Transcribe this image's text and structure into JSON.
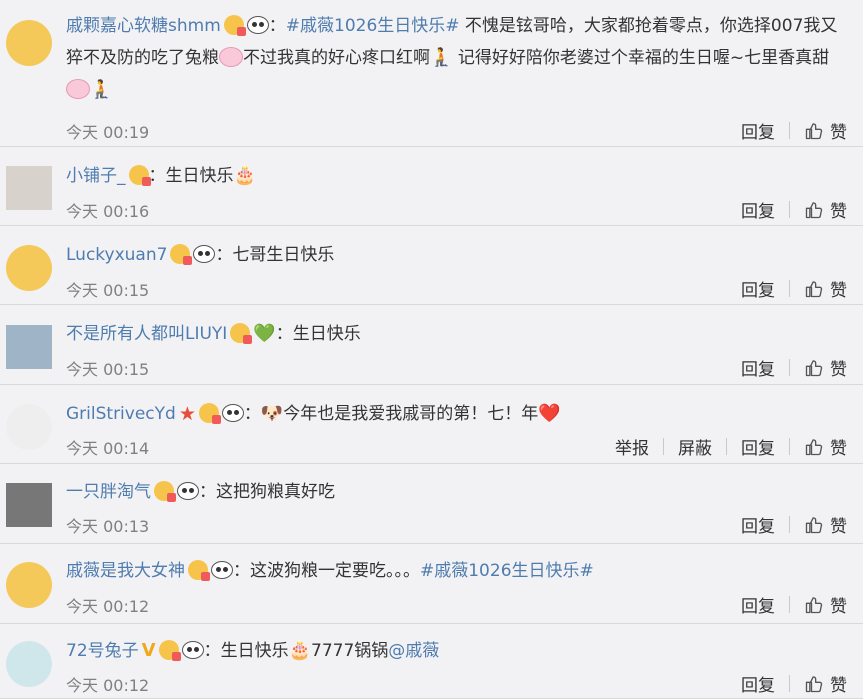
{
  "comments": [
    {
      "user": "戚颗嘉心软糖shmm",
      "badges": [
        "crown",
        "panda"
      ],
      "parts": [
        {
          "t": "：",
          "k": "text"
        },
        {
          "t": "#戚薇1026生日快乐#",
          "k": "link"
        },
        {
          "t": " 不愧是铉哥哈，大家都抢着零点，你选择007我又猝不及防的吃了兔粮",
          "k": "text"
        },
        {
          "t": "",
          "k": "pinkface"
        },
        {
          "t": "不过我真的好心疼口红啊",
          "k": "text"
        },
        {
          "t": "🧎",
          "k": "emoji"
        },
        {
          "t": " 记得好好陪你老婆过个幸福的生日喔~七里香真甜",
          "k": "text"
        },
        {
          "t": "",
          "k": "pinkface"
        },
        {
          "t": "🧎",
          "k": "emoji"
        }
      ],
      "time": "今天 00:19",
      "avatar_color": "#f4c95a",
      "actions": [
        "回复"
      ],
      "like": "赞"
    },
    {
      "user": "小铺子_",
      "badges": [
        "crown"
      ],
      "parts": [
        {
          "t": "：生日快乐",
          "k": "text"
        },
        {
          "t": "🎂",
          "k": "emoji"
        }
      ],
      "time": "今天 00:16",
      "avatar_color": "#d8d2cc",
      "actions": [
        "回复"
      ],
      "like": "赞"
    },
    {
      "user": "Luckyxuan7",
      "badges": [
        "crown",
        "panda"
      ],
      "parts": [
        {
          "t": "：七哥生日快乐",
          "k": "text"
        }
      ],
      "time": "今天 00:15",
      "avatar_color": "#f4c95a",
      "actions": [
        "回复"
      ],
      "like": "赞"
    },
    {
      "user": "不是所有人都叫LIUYI",
      "badges": [
        "crown",
        "greenheart"
      ],
      "parts": [
        {
          "t": "：生日快乐",
          "k": "text"
        }
      ],
      "time": "今天 00:15",
      "avatar_color": "#9fb4c6",
      "actions": [
        "回复"
      ],
      "like": "赞"
    },
    {
      "user": "GrilStrivecYd",
      "badges": [
        "star",
        "crown",
        "panda"
      ],
      "parts": [
        {
          "t": "：",
          "k": "text"
        },
        {
          "t": "🐶",
          "k": "emoji"
        },
        {
          "t": "今年也是我爱我戚哥的第！七！年",
          "k": "text"
        },
        {
          "t": "❤️",
          "k": "emoji"
        }
      ],
      "time": "今天 00:14",
      "avatar_color": "#eeeeee",
      "actions": [
        "举报",
        "屏蔽",
        "回复"
      ],
      "like": "赞"
    },
    {
      "user": "一只胖淘气",
      "badges": [
        "crown",
        "panda"
      ],
      "parts": [
        {
          "t": "：这把狗粮真好吃",
          "k": "text"
        }
      ],
      "time": "今天 00:13",
      "avatar_color": "#777777",
      "actions": [
        "回复"
      ],
      "like": "赞"
    },
    {
      "user": "戚薇是我大女神",
      "badges": [
        "crown",
        "panda"
      ],
      "parts": [
        {
          "t": "：这波狗粮一定要吃。。。",
          "k": "text"
        },
        {
          "t": "#戚薇1026生日快乐#",
          "k": "link"
        }
      ],
      "time": "今天 00:12",
      "avatar_color": "#f4c95a",
      "actions": [
        "回复"
      ],
      "like": "赞"
    },
    {
      "user": "72号兔子",
      "badges": [
        "vmark",
        "crown",
        "panda"
      ],
      "parts": [
        {
          "t": "：生日快乐",
          "k": "text"
        },
        {
          "t": "🎂",
          "k": "emoji"
        },
        {
          "t": "7777锅锅",
          "k": "text"
        },
        {
          "t": "@戚薇",
          "k": "link"
        }
      ],
      "time": "今天 00:12",
      "avatar_color": "#cfe7ea",
      "actions": [
        "回复"
      ],
      "like": "赞"
    }
  ]
}
